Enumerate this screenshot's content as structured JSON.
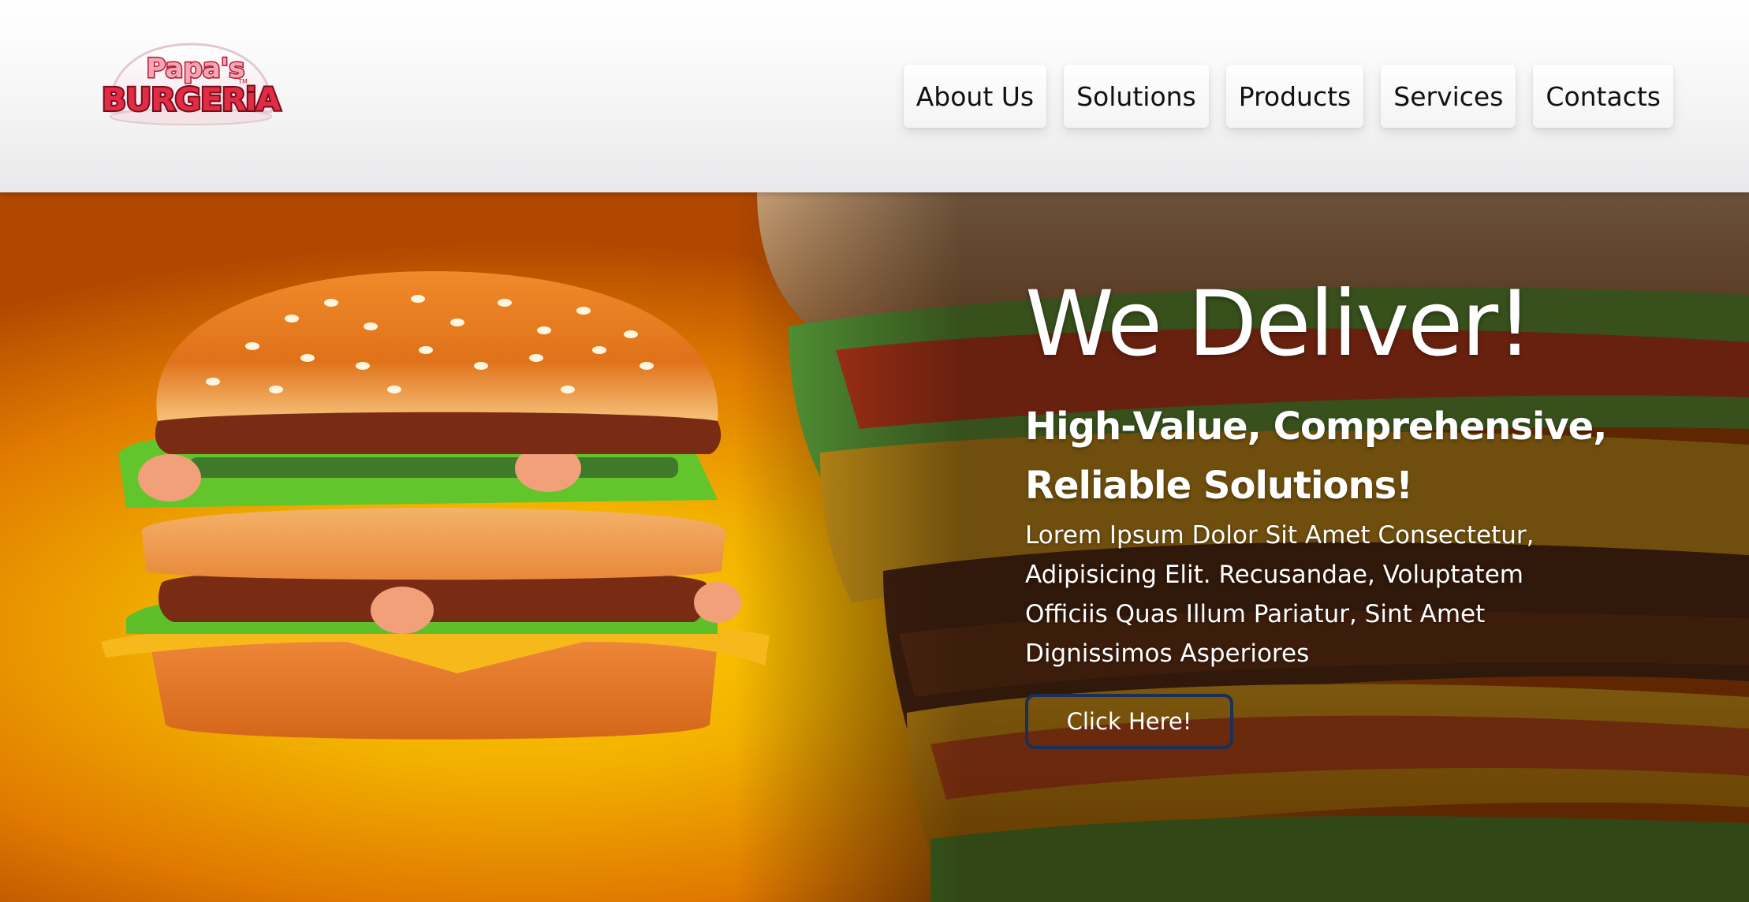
{
  "brand": {
    "logo_line1": "Papa's",
    "logo_line2": "BURGERiA",
    "logo_tm": "TM",
    "name": "Papa's Burgeria"
  },
  "nav": {
    "items": [
      {
        "label": "About Us"
      },
      {
        "label": "Solutions"
      },
      {
        "label": "Products"
      },
      {
        "label": "Services"
      },
      {
        "label": "Contacts"
      }
    ]
  },
  "hero": {
    "title": "We Deliver!",
    "subtitle_line1": "High-Value, Comprehensive,",
    "subtitle_line2": "Reliable Solutions!",
    "body_line1": "Lorem Ipsum Dolor Sit Amet Consectetur,",
    "body_line2": "Adipisicing Elit. Recusandae, Voluptatem",
    "body_line3": "Officiis Quas Illum Pariatur, Sint Amet",
    "body_line4": "Dignissimos Asperiores",
    "cta_label": "Click Here!"
  },
  "colors": {
    "header_bg": "#f5f5f6",
    "hero_glow": "#f0b400",
    "hero_dark": "#c24f00",
    "cta_border": "#1c2f57",
    "logo_red": "#d3223a",
    "text_light": "#ffffff"
  },
  "icons": {
    "logo": "papas-burgeria-logo",
    "hero_image": "burger-image"
  }
}
